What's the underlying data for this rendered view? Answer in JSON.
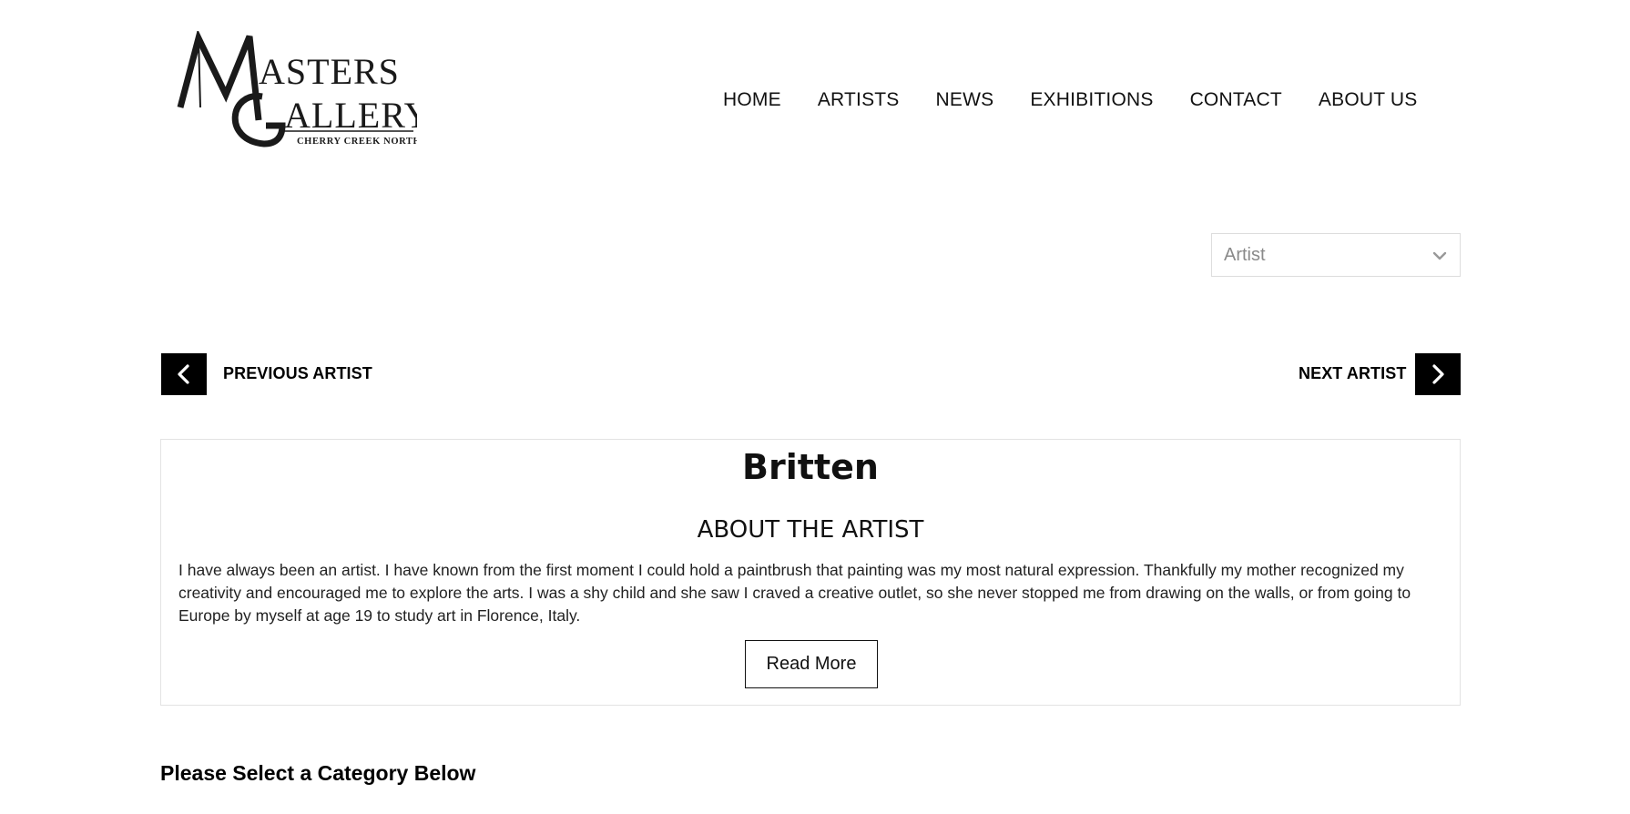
{
  "logo": {
    "alt": "Masters Gallery",
    "line1": "MASTERS",
    "line2": "GALLERY",
    "subtitle": "CHERRY CREEK NORTH"
  },
  "nav": {
    "items": [
      {
        "label": "HOME"
      },
      {
        "label": "ARTISTS"
      },
      {
        "label": "NEWS"
      },
      {
        "label": "EXHIBITIONS"
      },
      {
        "label": "CONTACT"
      },
      {
        "label": "ABOUT US"
      }
    ]
  },
  "artist_select": {
    "value": "Artist",
    "icon": "chevron-down-icon"
  },
  "pager": {
    "prev_label": "PREVIOUS ARTIST",
    "next_label": "NEXT ARTIST",
    "prev_icon": "chevron-left-icon",
    "next_icon": "chevron-right-icon"
  },
  "artist": {
    "name": "Britten",
    "about_heading": "ABOUT THE ARTIST",
    "about_text": "I have always been an artist. I have known from the first moment I could hold a paintbrush that painting was my most natural expression. Thankfully my mother recognized my creativity and encouraged me to explore the arts. I was a shy child and she saw I craved a creative outlet, so she never stopped me from drawing on the walls, or from going to Europe by myself at age 19 to study art in Florence, Italy.",
    "read_more_label": "Read More"
  },
  "category": {
    "heading": "Please Select a Category Below"
  }
}
